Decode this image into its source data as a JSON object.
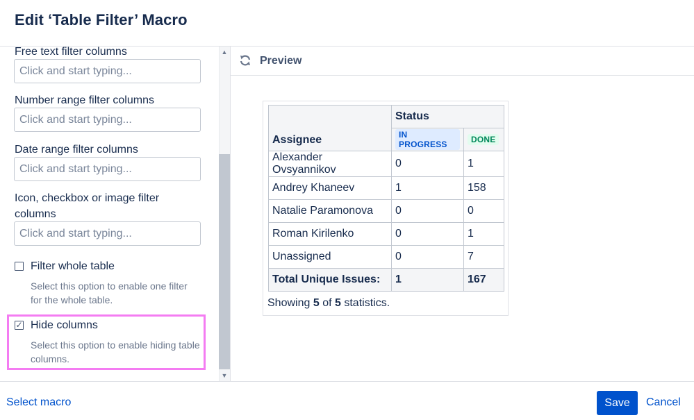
{
  "dialog": {
    "title": "Edit ‘Table Filter’ Macro"
  },
  "left_panel": {
    "fields": [
      {
        "label": "Free text filter columns",
        "placeholder": "Click and start typing..."
      },
      {
        "label": "Number range filter columns",
        "placeholder": "Click and start typing..."
      },
      {
        "label": "Date range filter columns",
        "placeholder": "Click and start typing..."
      },
      {
        "label_line1": "Icon, checkbox or image filter",
        "label_line2": "columns",
        "placeholder": "Click and start typing..."
      }
    ],
    "filter_whole_table": {
      "label": "Filter whole table",
      "checked": false,
      "desc_line1": "Select this option to enable one filter",
      "desc_line2": "for the whole table."
    },
    "hide_columns": {
      "label": "Hide columns",
      "checked": true,
      "check_glyph": "✓",
      "desc_line1": "Select this option to enable hiding table",
      "desc_line2": "columns."
    }
  },
  "preview": {
    "label": "Preview",
    "icon": "refresh-icon",
    "table": {
      "assignee_header": "Assignee",
      "status_header": "Status",
      "status_columns": [
        {
          "label": "IN PROGRESS",
          "color": "#0052cc"
        },
        {
          "label": "DONE",
          "color": "#00875a"
        }
      ],
      "rows": [
        {
          "assignee": "Alexander Ovsyannikov",
          "in_progress": "0",
          "done": "1"
        },
        {
          "assignee": "Andrey Khaneev",
          "in_progress": "1",
          "done": "158"
        },
        {
          "assignee": "Natalie Paramonova",
          "in_progress": "0",
          "done": "0"
        },
        {
          "assignee": "Roman Kirilenko",
          "in_progress": "0",
          "done": "1"
        },
        {
          "assignee": "Unassigned",
          "in_progress": "0",
          "done": "7"
        }
      ],
      "total": {
        "label": "Total Unique Issues:",
        "in_progress": "1",
        "done": "167"
      }
    },
    "showing": {
      "prefix": "Showing",
      "count": "5",
      "of": "of",
      "total": "5",
      "suffix": "statistics."
    }
  },
  "footer": {
    "select_macro": "Select macro",
    "save": "Save",
    "cancel": "Cancel"
  },
  "colors": {
    "accent": "#0052cc",
    "highlight": "#f47cf2"
  }
}
